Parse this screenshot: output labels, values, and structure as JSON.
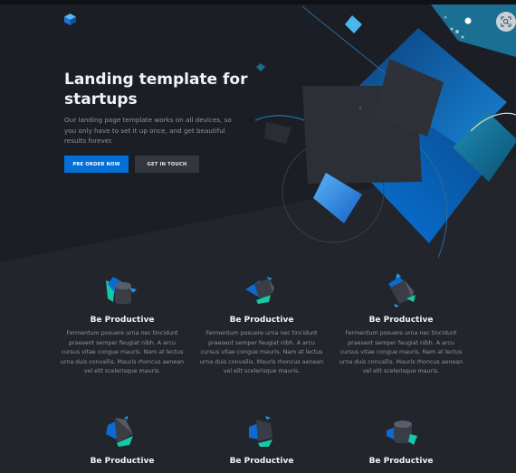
{
  "hero": {
    "title": "Landing template for startups",
    "description": "Our landing page template works on all devices, so you only have to set it up once, and get beautiful results forever.",
    "primary_button": "PRE ORDER NOW",
    "secondary_button": "GET IN TOUCH"
  },
  "features": [
    {
      "title": "Be Productive",
      "text": "Fermentum posuere urna nec tincidunt praesent semper feugiat nibh. A arcu cursus vitae congue mauris. Nam at lectus urna duis convallis. Mauris rhoncus aenean vel elit scelerisque mauris.",
      "icon": "cylinder-icon"
    },
    {
      "title": "Be Productive",
      "text": "Fermentum posuere urna nec tincidunt praesent semper feugiat nibh. A arcu cursus vitae congue mauris. Nam at lectus urna duis convallis. Mauris rhoncus aenean vel elit scelerisque mauris.",
      "icon": "cube-icon"
    },
    {
      "title": "Be Productive",
      "text": "Fermentum posuere urna nec tincidunt praesent semper feugiat nibh. A arcu cursus vitae congue mauris. Nam at lectus urna duis convallis. Mauris rhoncus aenean vel elit scelerisque mauris.",
      "icon": "prism-icon"
    },
    {
      "title": "Be Productive",
      "text": "",
      "icon": "pyramid-icon"
    },
    {
      "title": "Be Productive",
      "text": "",
      "icon": "cube-icon"
    },
    {
      "title": "Be Productive",
      "text": "",
      "icon": "cylinder-icon"
    }
  ],
  "colors": {
    "background": "#22252c",
    "accent": "#0270d7",
    "teal": "#14c8a8",
    "text_primary": "#f2f3f5",
    "text_secondary": "#8d939e"
  },
  "icons": {
    "logo": "cube-logo-icon",
    "corner": "image-search-icon"
  }
}
